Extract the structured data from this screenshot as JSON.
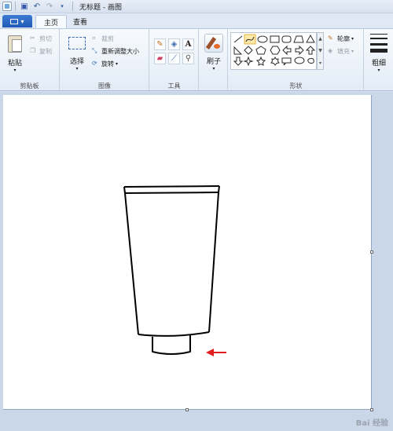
{
  "titlebar": {
    "title": "无标题 - 画图",
    "quick_access": [
      "save-icon",
      "undo-icon",
      "redo-icon",
      "customize-icon"
    ]
  },
  "tabs": {
    "file_label": "",
    "home": "主页",
    "view": "查看"
  },
  "ribbon": {
    "clipboard": {
      "paste": "粘贴",
      "cut": "剪切",
      "copy": "复制",
      "group": "剪贴板"
    },
    "image": {
      "select": "选择",
      "crop": "裁剪",
      "resize": "重新调整大小",
      "rotate": "旋转",
      "group": "图像"
    },
    "tools": {
      "group": "工具",
      "items": [
        "pencil-icon",
        "fill-icon",
        "text-icon",
        "eraser-icon",
        "color-picker-icon",
        "magnifier-icon"
      ]
    },
    "brushes": {
      "label": "刷子"
    },
    "shapes": {
      "group": "形状",
      "outline": "轮廓",
      "fill": "填充"
    },
    "size": {
      "label": "粗细"
    }
  },
  "watermark": "Bai 经验"
}
